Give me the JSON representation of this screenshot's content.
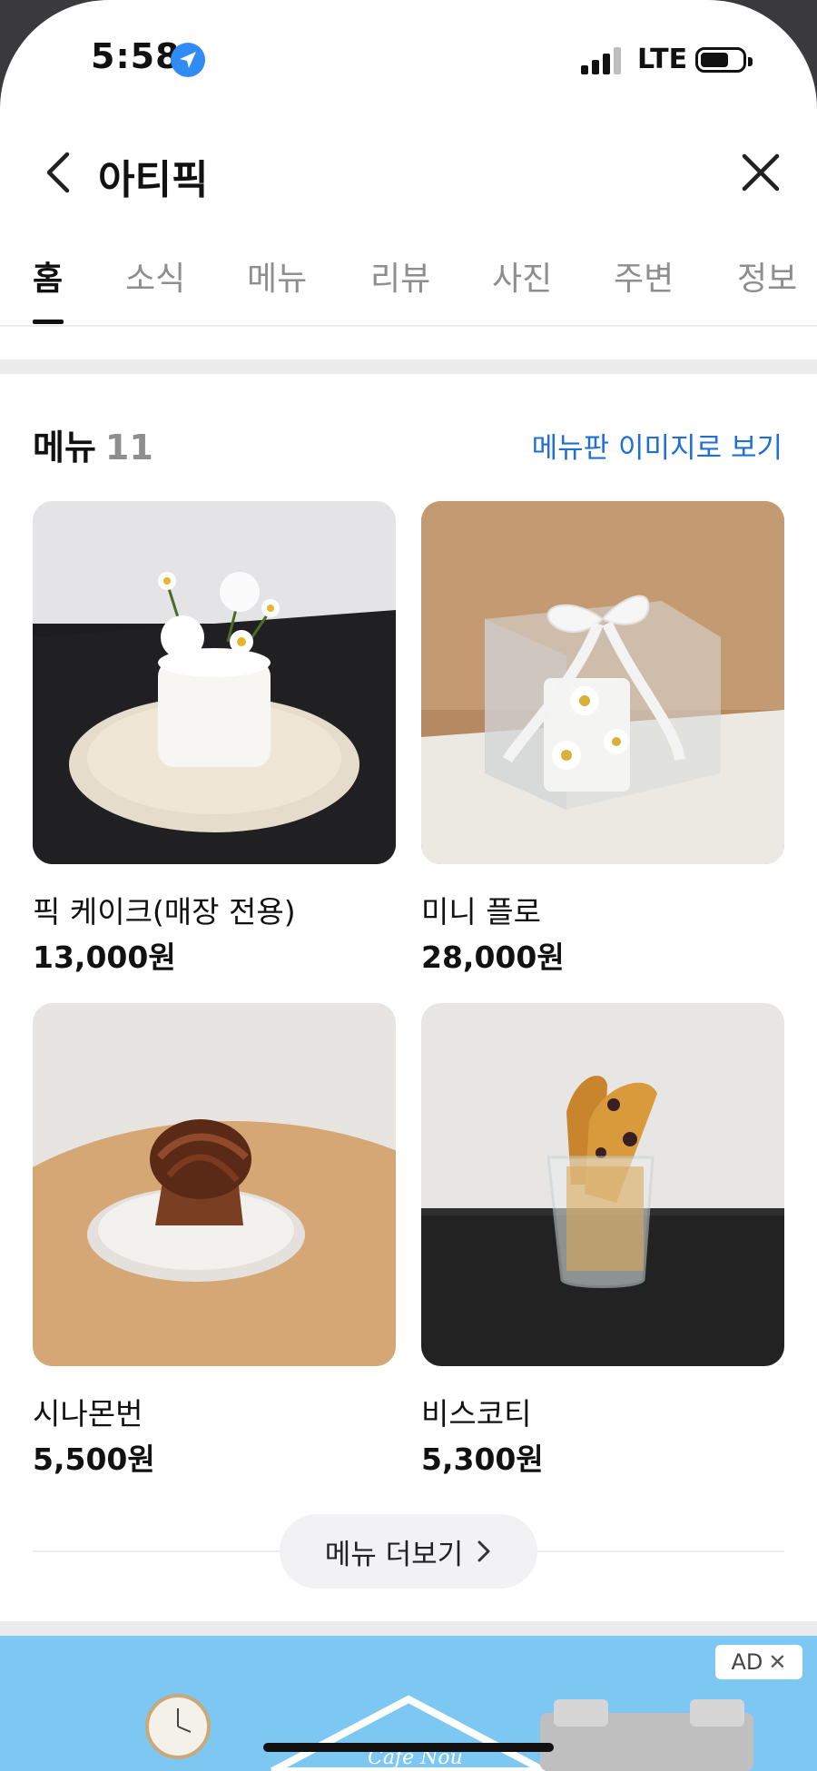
{
  "status_bar": {
    "time": "5:58",
    "network": "LTE"
  },
  "header": {
    "title": "아티픽"
  },
  "tabs": [
    {
      "label": "홈",
      "active": true
    },
    {
      "label": "소식"
    },
    {
      "label": "메뉴"
    },
    {
      "label": "리뷰"
    },
    {
      "label": "사진"
    },
    {
      "label": "주변"
    },
    {
      "label": "정보"
    }
  ],
  "menu_section": {
    "title": "메뉴",
    "count": "11",
    "board_link": "메뉴판 이미지로 보기",
    "items": [
      {
        "name": "픽 케이크(매장 전용)",
        "price": "13,000원"
      },
      {
        "name": "미니 플로",
        "price": "28,000원"
      },
      {
        "name": "시나몬번",
        "price": "5,500원"
      },
      {
        "name": "비스코티",
        "price": "5,300원"
      }
    ],
    "more_label": "메뉴 더보기"
  },
  "ad": {
    "badge": "AD",
    "brand": "Cafe Nou"
  },
  "colors": {
    "accent_link": "#1f6fd8",
    "ad_bg": "#7cc8f2"
  },
  "icons": [
    "location-arrow-icon",
    "signal-icon",
    "battery-icon",
    "back-chevron-icon",
    "close-icon",
    "chevron-right-icon"
  ]
}
